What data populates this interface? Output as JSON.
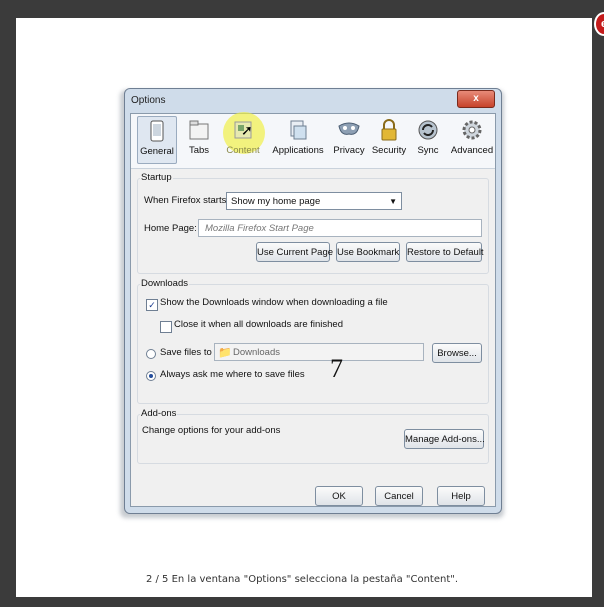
{
  "window": {
    "title": "Options",
    "close_glyph": "x"
  },
  "toolbar": {
    "tabs": [
      {
        "label": "General",
        "icon": "general-icon"
      },
      {
        "label": "Tabs",
        "icon": "tabs-icon"
      },
      {
        "label": "Content",
        "icon": "content-icon"
      },
      {
        "label": "Applications",
        "icon": "applications-icon"
      },
      {
        "label": "Privacy",
        "icon": "privacy-mask-icon"
      },
      {
        "label": "Security",
        "icon": "lock-icon"
      },
      {
        "label": "Sync",
        "icon": "sync-icon"
      },
      {
        "label": "Advanced",
        "icon": "gear-icon"
      }
    ],
    "selected": "General"
  },
  "startup": {
    "legend": "Startup",
    "when_label": "When Firefox starts:",
    "when_value": "Show my home page",
    "home_label": "Home Page:",
    "home_placeholder": "Mozilla Firefox Start Page",
    "use_current": "Use Current Page",
    "use_bookmark": "Use Bookmark",
    "restore_default": "Restore to Default"
  },
  "downloads": {
    "legend": "Downloads",
    "show_window": "Show the Downloads window when downloading a file",
    "show_window_checked": true,
    "close_it": "Close it when all downloads are finished",
    "close_it_checked": false,
    "save_files_to": "Save files to",
    "folder": "Downloads",
    "browse": "Browse...",
    "always_ask": "Always ask me where to save files",
    "selected_option": "always_ask"
  },
  "addons": {
    "legend": "Add-ons",
    "description": "Change options for your add-ons",
    "manage": "Manage Add-ons..."
  },
  "footer": {
    "ok": "OK",
    "cancel": "Cancel",
    "help": "Help"
  },
  "annotation": {
    "step_number": "7"
  },
  "viewer": {
    "caption": "2 / 5   En la ventana \"Options\" selecciona la pestaña \"Content\".",
    "close_glyph": "e"
  }
}
